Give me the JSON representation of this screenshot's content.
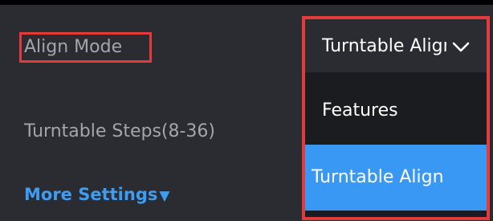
{
  "settings": {
    "align_mode_label": "Align Mode",
    "turntable_steps_label": "Turntable Steps(8-36)",
    "more_settings_label": "More Settings",
    "more_settings_caret": "▼"
  },
  "dropdown": {
    "selected_value": "Turntable Align",
    "chevron_icon": "chevron-down-icon",
    "options": [
      {
        "label": "Features",
        "highlighted": false
      },
      {
        "label": "Turntable Align",
        "highlighted": true
      }
    ]
  },
  "colors": {
    "background": "#2a2c31",
    "label_text": "#a2a5ab",
    "link_accent": "#3d9df5",
    "dropdown_background": "#1b1c20",
    "highlight_option": "#3a98f5",
    "annotation_red": "#e33b3b"
  }
}
